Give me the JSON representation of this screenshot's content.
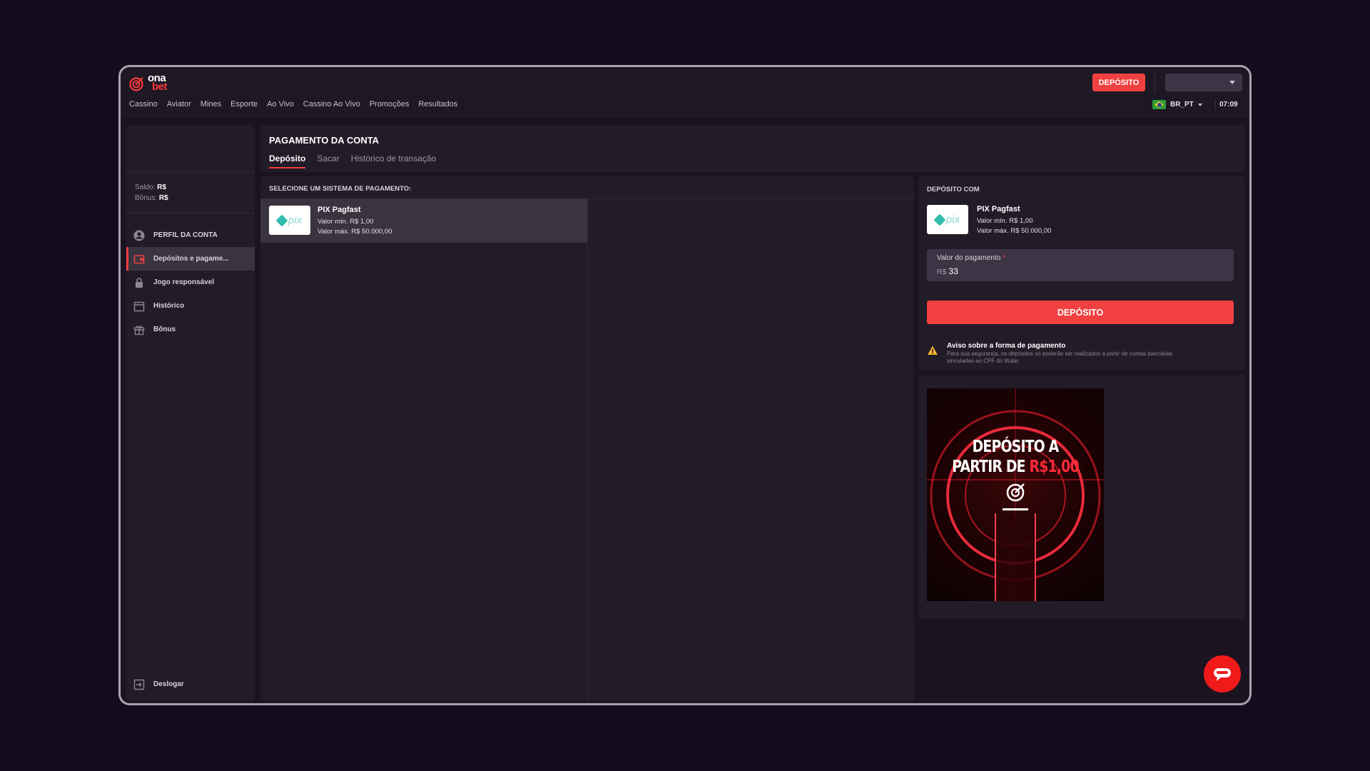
{
  "brand": {
    "logo_top": "ona",
    "logo_bottom": "bet"
  },
  "nav": [
    "Cassino",
    "Aviator",
    "Mines",
    "Esporte",
    "Ao Vivo",
    "Cassino Ao Vivo",
    "Promoções",
    "Resultados"
  ],
  "header": {
    "deposit_label": "DEPÓSITO",
    "language": "BR_PT",
    "time": "07:09"
  },
  "sidebar": {
    "balance_label": "Saldo:",
    "balance_value": "R$",
    "bonus_label": "Bônus:",
    "bonus_value": "R$",
    "items": [
      {
        "label": "PERFIL DA CONTA",
        "icon": "user-circle-icon"
      },
      {
        "label": "Depósitos e pagame...",
        "icon": "wallet-icon"
      },
      {
        "label": "Jogo responsável",
        "icon": "lock-icon"
      },
      {
        "label": "Histórico",
        "icon": "calendar-icon"
      },
      {
        "label": "Bônus",
        "icon": "gift-icon"
      }
    ],
    "logout_label": "Deslogar"
  },
  "main": {
    "title": "PAGAMENTO DA CONTA",
    "tabs": [
      "Depósito",
      "Sacar",
      "Histórico de transação"
    ],
    "select_title": "SELECIONE UM SISTEMA DE PAGAMENTO:",
    "method": {
      "name": "PIX Pagfast",
      "min": "Valor mín. R$ 1,00",
      "max": "Valor máx. R$ 50.000,00",
      "logo_text": "pix"
    }
  },
  "deposit": {
    "title": "DEPÓSITO COM",
    "amount_label": "Valor do pagamento",
    "required_mark": "*",
    "currency": "R$",
    "amount_value": "33",
    "button_label": "DEPÓSITO",
    "notice_title": "Aviso sobre a forma de pagamento",
    "notice_text": "Para sua segurança, os depósitos só poderão ser realizados a partir de contas bancárias vinculadas ao CPF do titular."
  },
  "banner": {
    "line1": "DEPÓSITO A",
    "line2a": "PARTIR DE ",
    "line2b": "R$1,00"
  },
  "colors": {
    "accent": "#f04040",
    "background": "#140b1c",
    "panel": "#221b28"
  }
}
